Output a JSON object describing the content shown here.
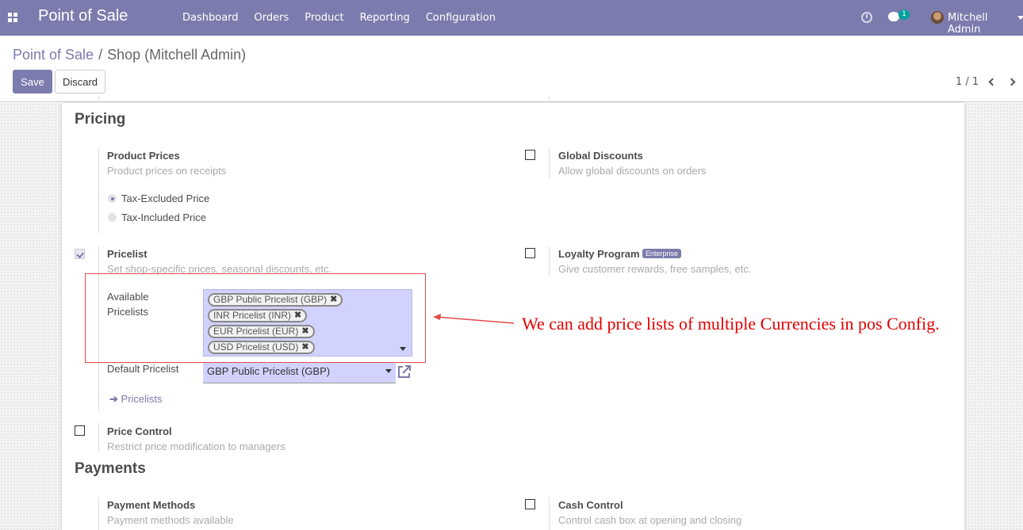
{
  "navbar": {
    "app_title": "Point of Sale",
    "menu": [
      "Dashboard",
      "Orders",
      "Product",
      "Reporting",
      "Configuration"
    ],
    "chat_badge": "1",
    "user_name": "Mitchell Admin"
  },
  "breadcrumb": {
    "parent": "Point of Sale",
    "separator": "/",
    "current": "Shop (Mitchell Admin)"
  },
  "buttons": {
    "save": "Save",
    "discard": "Discard"
  },
  "pager": {
    "text": "1 / 1"
  },
  "pricing": {
    "title": "Pricing",
    "product_prices": {
      "title": "Product Prices",
      "desc": "Product prices on receipts",
      "options": [
        "Tax-Excluded Price",
        "Tax-Included Price"
      ],
      "selected": "Tax-Excluded Price"
    },
    "global_discounts": {
      "title": "Global Discounts",
      "desc": "Allow global discounts on orders",
      "checked": false
    },
    "pricelist": {
      "title": "Pricelist",
      "desc": "Set shop-specific prices, seasonal discounts, etc.",
      "checked": true,
      "available_label_1": "Available",
      "available_label_2": "Pricelists",
      "available": [
        "GBP Public Pricelist (GBP)",
        "INR Pricelist (INR)",
        "EUR Pricelist (EUR)",
        "USD Pricelist (USD)"
      ],
      "default_label": "Default Pricelist",
      "default_value": "GBP Public Pricelist (GBP)",
      "link": "Pricelists"
    },
    "loyalty": {
      "title": "Loyalty Program",
      "badge": "Enterprise",
      "desc": "Give customer rewards, free samples, etc.",
      "checked": false
    },
    "price_control": {
      "title": "Price Control",
      "desc": "Restrict price modification to managers",
      "checked": false
    }
  },
  "payments": {
    "title": "Payments",
    "payment_methods": {
      "title": "Payment Methods",
      "desc": "Payment methods available"
    },
    "cash_control": {
      "title": "Cash Control",
      "desc": "Control cash box at opening and closing",
      "checked": false
    }
  },
  "annotation": {
    "text": "We can add price lists of multiple Currencies in pos Config.",
    "color": "#e10000"
  },
  "colors": {
    "brand": "#7c7bad",
    "field_bg": "#d2d2ff",
    "teal_badge": "#00a09d"
  },
  "icons": [
    "apps-icon",
    "clock-icon",
    "chat-icon",
    "avatar",
    "caret-down-icon",
    "chevron-left-icon",
    "chevron-right-icon",
    "external-link-icon",
    "arrow-right-icon",
    "remove-tag-icon"
  ]
}
